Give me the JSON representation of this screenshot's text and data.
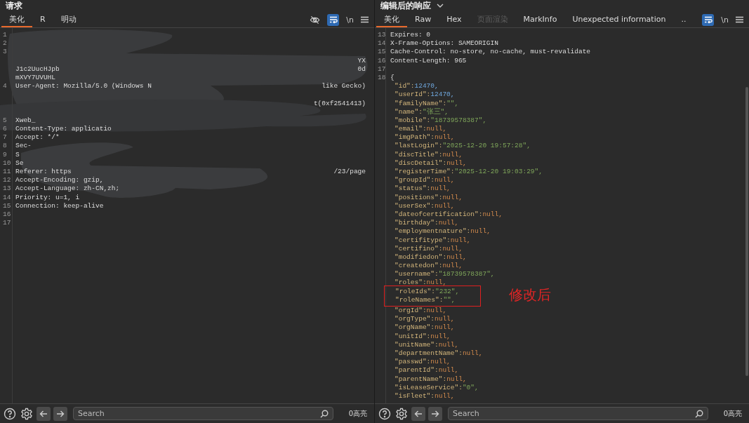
{
  "request_panel": {
    "title": "请求",
    "tabs": [
      {
        "label": "美化",
        "selected": true
      },
      {
        "label": "R",
        "selected": false
      },
      {
        "label": "明动",
        "selected": false
      }
    ],
    "toolbar": {
      "hide_icon": true,
      "wrap_on": true,
      "newline_label": "\\n"
    },
    "lines": [
      {
        "kind": "line",
        "num": "1"
      },
      {
        "kind": "line",
        "num": "2"
      },
      {
        "kind": "line",
        "num": "3"
      },
      {
        "kind": "line",
        "tail": "YX"
      },
      {
        "kind": "line",
        "text": "J1c2UucHJpb",
        "tail": "0d"
      },
      {
        "kind": "line",
        "text": "mXVY7UVUHL"
      },
      {
        "kind": "line",
        "num": "4",
        "text": "User-Agent: Mozilla/5.0 (Windows N",
        "tail": "like Gecko)"
      },
      {
        "kind": "blank"
      },
      {
        "kind": "line",
        "tail": "t(0xf2541413)"
      },
      {
        "kind": "blank"
      },
      {
        "kind": "line",
        "num": "5",
        "text": "Xweb_"
      },
      {
        "kind": "line",
        "num": "6",
        "text": "Content-Type: applicatio"
      },
      {
        "kind": "line",
        "num": "7",
        "text": "Accept: */*"
      },
      {
        "kind": "line",
        "num": "8",
        "text": "Sec-"
      },
      {
        "kind": "line",
        "num": "9",
        "text": "S"
      },
      {
        "kind": "line",
        "num": "10",
        "text": "Se"
      },
      {
        "kind": "line",
        "num": "11",
        "text": "Referer: https",
        "tail": "/23/page"
      },
      {
        "kind": "line",
        "num": "12",
        "text": "Accept-Encoding: gzip,"
      },
      {
        "kind": "line",
        "num": "13",
        "text": "Accept-Language: zh-CN,zh;"
      },
      {
        "kind": "line",
        "num": "14",
        "text": "Priority: u=1, i"
      },
      {
        "kind": "line",
        "num": "15",
        "text": "Connection: keep-alive"
      },
      {
        "kind": "line",
        "num": "16"
      },
      {
        "kind": "line",
        "num": "17"
      }
    ],
    "search": {
      "placeholder": "Search"
    },
    "highlights": "0高亮"
  },
  "response_panel": {
    "title": "编辑后的响应",
    "tabs": [
      {
        "label": "美化",
        "selected": true,
        "disabled": false
      },
      {
        "label": "Raw",
        "selected": false,
        "disabled": false
      },
      {
        "label": "Hex",
        "selected": false,
        "disabled": false
      },
      {
        "label": "页面渲染",
        "selected": false,
        "disabled": true
      },
      {
        "label": "MarkInfo",
        "selected": false,
        "disabled": false
      },
      {
        "label": "Unexpected information",
        "selected": false,
        "disabled": false
      },
      {
        "label": "..",
        "selected": false,
        "disabled": false
      }
    ],
    "toolbar": {
      "wrap_on": true,
      "newline_label": "\\n"
    },
    "header_lines": [
      {
        "num": "13",
        "text": "Expires: 0"
      },
      {
        "num": "14",
        "text": "X-Frame-Options: SAMEORIGIN"
      },
      {
        "num": "15",
        "text": "Cache-Control: no-store, no-cache, must-revalidate"
      },
      {
        "num": "16",
        "text": "Content-Length: 965"
      },
      {
        "num": "17"
      },
      {
        "num": "18",
        "text": "{"
      }
    ],
    "json_lines": [
      {
        "key": "\"id\":",
        "value": "12470,",
        "kind": "number",
        "boxed": false
      },
      {
        "key": "\"userId\":",
        "value": "12470,",
        "kind": "number",
        "boxed": false
      },
      {
        "key": "\"familyName\":",
        "value": "\"\",",
        "kind": "string",
        "boxed": false
      },
      {
        "key": "\"name\":",
        "value": "\"张三\",",
        "kind": "string",
        "boxed": false
      },
      {
        "key": "\"mobile\":",
        "value": "\"18739578387\",",
        "kind": "string",
        "boxed": false
      },
      {
        "key": "\"email\":",
        "value": "null,",
        "kind": "null",
        "boxed": false
      },
      {
        "key": "\"imgPath\":",
        "value": "null,",
        "kind": "null",
        "boxed": false
      },
      {
        "key": "\"lastLogin\":",
        "value": "\"2025-12-20 19:57:28\",",
        "kind": "string",
        "boxed": false
      },
      {
        "key": "\"discTitle\":",
        "value": "null,",
        "kind": "null",
        "boxed": false
      },
      {
        "key": "\"discDetail\":",
        "value": "null,",
        "kind": "null",
        "boxed": false
      },
      {
        "key": "\"registerTime\":",
        "value": "\"2025-12-20 19:03:29\",",
        "kind": "string",
        "boxed": false
      },
      {
        "key": "\"groupId\":",
        "value": "null,",
        "kind": "null",
        "boxed": false
      },
      {
        "key": "\"status\":",
        "value": "null,",
        "kind": "null",
        "boxed": false
      },
      {
        "key": "\"positions\":",
        "value": "null,",
        "kind": "null",
        "boxed": false
      },
      {
        "key": "\"userSex\":",
        "value": "null,",
        "kind": "null",
        "boxed": false
      },
      {
        "key": "\"dateofcertification\":",
        "value": "null,",
        "kind": "null",
        "boxed": false
      },
      {
        "key": "\"birthday\":",
        "value": "null,",
        "kind": "null",
        "boxed": false
      },
      {
        "key": "\"employmentnature\":",
        "value": "null,",
        "kind": "null",
        "boxed": false
      },
      {
        "key": "\"certifitype\":",
        "value": "null,",
        "kind": "null",
        "boxed": false
      },
      {
        "key": "\"certifino\":",
        "value": "null,",
        "kind": "null",
        "boxed": false
      },
      {
        "key": "\"modifiedon\":",
        "value": "null,",
        "kind": "null",
        "boxed": false
      },
      {
        "key": "\"createdon\":",
        "value": "null,",
        "kind": "null",
        "boxed": false
      },
      {
        "key": "\"username\":",
        "value": "\"18739578387\",",
        "kind": "string",
        "boxed": false
      },
      {
        "key": "\"roles\":",
        "value": "null,",
        "kind": "null",
        "boxed": false
      },
      {
        "key": "\"roleIds\":",
        "value": "\"232\",",
        "kind": "string",
        "boxed": true
      },
      {
        "key": "\"roleNames\":",
        "value": "\"\",",
        "kind": "string",
        "boxed": true
      },
      {
        "key": "\"orgId\":",
        "value": "null,",
        "kind": "null",
        "boxed": false
      },
      {
        "key": "\"orgType\":",
        "value": "null,",
        "kind": "null",
        "boxed": false
      },
      {
        "key": "\"orgName\":",
        "value": "null,",
        "kind": "null",
        "boxed": false
      },
      {
        "key": "\"unitId\":",
        "value": "null,",
        "kind": "null",
        "boxed": false
      },
      {
        "key": "\"unitName\":",
        "value": "null,",
        "kind": "null",
        "boxed": false
      },
      {
        "key": "\"departmentName\":",
        "value": "null,",
        "kind": "null",
        "boxed": false
      },
      {
        "key": "\"passwd\":",
        "value": "null,",
        "kind": "null",
        "boxed": false
      },
      {
        "key": "\"parentId\":",
        "value": "null,",
        "kind": "null",
        "boxed": false
      },
      {
        "key": "\"parentName\":",
        "value": "null,",
        "kind": "null",
        "boxed": false
      },
      {
        "key": "\"isLeaseService\":",
        "value": "\"0\",",
        "kind": "string",
        "boxed": false
      },
      {
        "key": "\"isFleet\":",
        "value": "null,",
        "kind": "null",
        "boxed": false
      }
    ],
    "annotation": "修改后",
    "search": {
      "placeholder": "Search"
    },
    "highlights": "0高亮"
  }
}
